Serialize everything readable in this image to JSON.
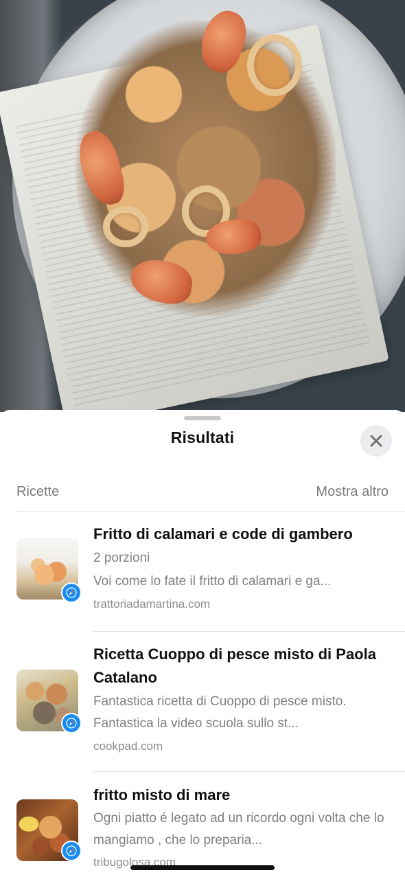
{
  "sheet": {
    "title": "Risultati",
    "close_icon": "close-icon"
  },
  "section": {
    "label": "Ricette",
    "more_label": "Mostra altro"
  },
  "results": [
    {
      "title": "Fritto di calamari e code di gambero",
      "subtitle": "2 porzioni",
      "description": "Voi come lo fate il fritto di calamari e ga...",
      "source": "trattoriadamartina.com",
      "badge_icon": "safari-icon"
    },
    {
      "title": "Ricetta Cuoppo di pesce misto di Paola Catalano",
      "description": "Fantastica ricetta di Cuoppo di pesce misto. Fantastica la video scuola sullo st...",
      "source": "cookpad.com",
      "badge_icon": "safari-icon"
    },
    {
      "title": "fritto misto di mare",
      "description": "Ogni piatto é legato ad un ricordo ogni volta che lo mangiamo , che lo preparia...",
      "source": "tribugolosa.com",
      "badge_icon": "safari-icon"
    }
  ],
  "colors": {
    "accent_blue": "#1a8cf0",
    "secondary_text": "#808085"
  }
}
